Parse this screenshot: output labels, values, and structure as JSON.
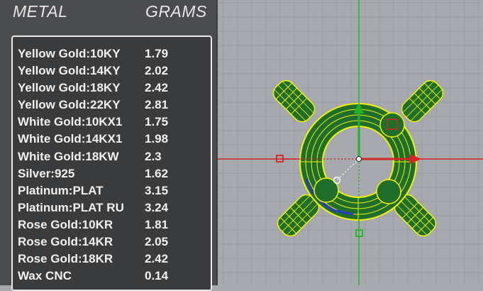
{
  "panel": {
    "header_metal": "METAL",
    "header_grams": "GRAMS",
    "rows": [
      {
        "metal": "Yellow Gold:10KY",
        "grams": "1.79"
      },
      {
        "metal": "Yellow Gold:14KY",
        "grams": "2.02"
      },
      {
        "metal": "Yellow Gold:18KY",
        "grams": "2.42"
      },
      {
        "metal": "Yellow Gold:22KY",
        "grams": "2.81"
      },
      {
        "metal": "White Gold:10KX1",
        "grams": "1.75"
      },
      {
        "metal": "White Gold:14KX1",
        "grams": "1.98"
      },
      {
        "metal": "White Gold:18KW",
        "grams": "2.3"
      },
      {
        "metal": "Silver:925",
        "grams": "1.62"
      },
      {
        "metal": "Platinum:PLAT",
        "grams": "3.15"
      },
      {
        "metal": "Platinum:PLAT RU",
        "grams": "3.24"
      },
      {
        "metal": "Rose Gold:10KR",
        "grams": "1.81"
      },
      {
        "metal": "Rose Gold:14KR",
        "grams": "2.05"
      },
      {
        "metal": "Rose Gold:18KR",
        "grams": "2.42"
      },
      {
        "metal": "Wax  CNC",
        "grams": "0.14"
      }
    ]
  },
  "viewport": {
    "background_color": "#a6a9ad",
    "grid_color": "#989ba0",
    "x_axis_color": "#e02020",
    "y_axis_color": "#1fb31f",
    "selection_color": "#f4f20a",
    "model_color": "#1f6e2c"
  }
}
